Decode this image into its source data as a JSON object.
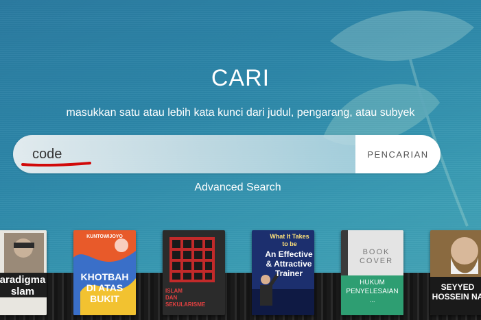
{
  "search": {
    "title": "CARI",
    "subtitle": "masukkan satu atau lebih kata kunci dari judul, pengarang, atau subyek",
    "input_value": "code",
    "button_label": "PENCARIAN",
    "advanced_label": "Advanced Search"
  },
  "books": [
    {
      "name": "book-paradigma-islam",
      "lines": [
        "aradigma",
        "slam"
      ]
    },
    {
      "name": "book-khotbah-di-atas-bukit",
      "author": "KUNTOWIJOYO",
      "lines": [
        "KHOTBAH",
        "DI ATAS",
        "BUKIT"
      ]
    },
    {
      "name": "book-islam-dan-sekularisme",
      "lines": [
        "ISLAM",
        "DAN",
        "SEKULARISME"
      ]
    },
    {
      "name": "book-effective-trainer",
      "lines": [
        "What It Takes",
        "to be",
        "An Effective",
        "& Attractive",
        "Trainer"
      ]
    },
    {
      "name": "book-hukum-penyelesaian",
      "placeholder": [
        "BOOK",
        "COVER"
      ],
      "lines": [
        "HUKUM",
        "PENYELESAIAN",
        "..."
      ]
    },
    {
      "name": "book-seyyed-hossein-nasr",
      "lines": [
        "SEYYED",
        "HOSSEIN NA"
      ]
    }
  ],
  "colors": {
    "background": "#2c86a8",
    "annotation_underline": "#d10a0a",
    "placeholder_label_bg": "#2e9e72"
  }
}
